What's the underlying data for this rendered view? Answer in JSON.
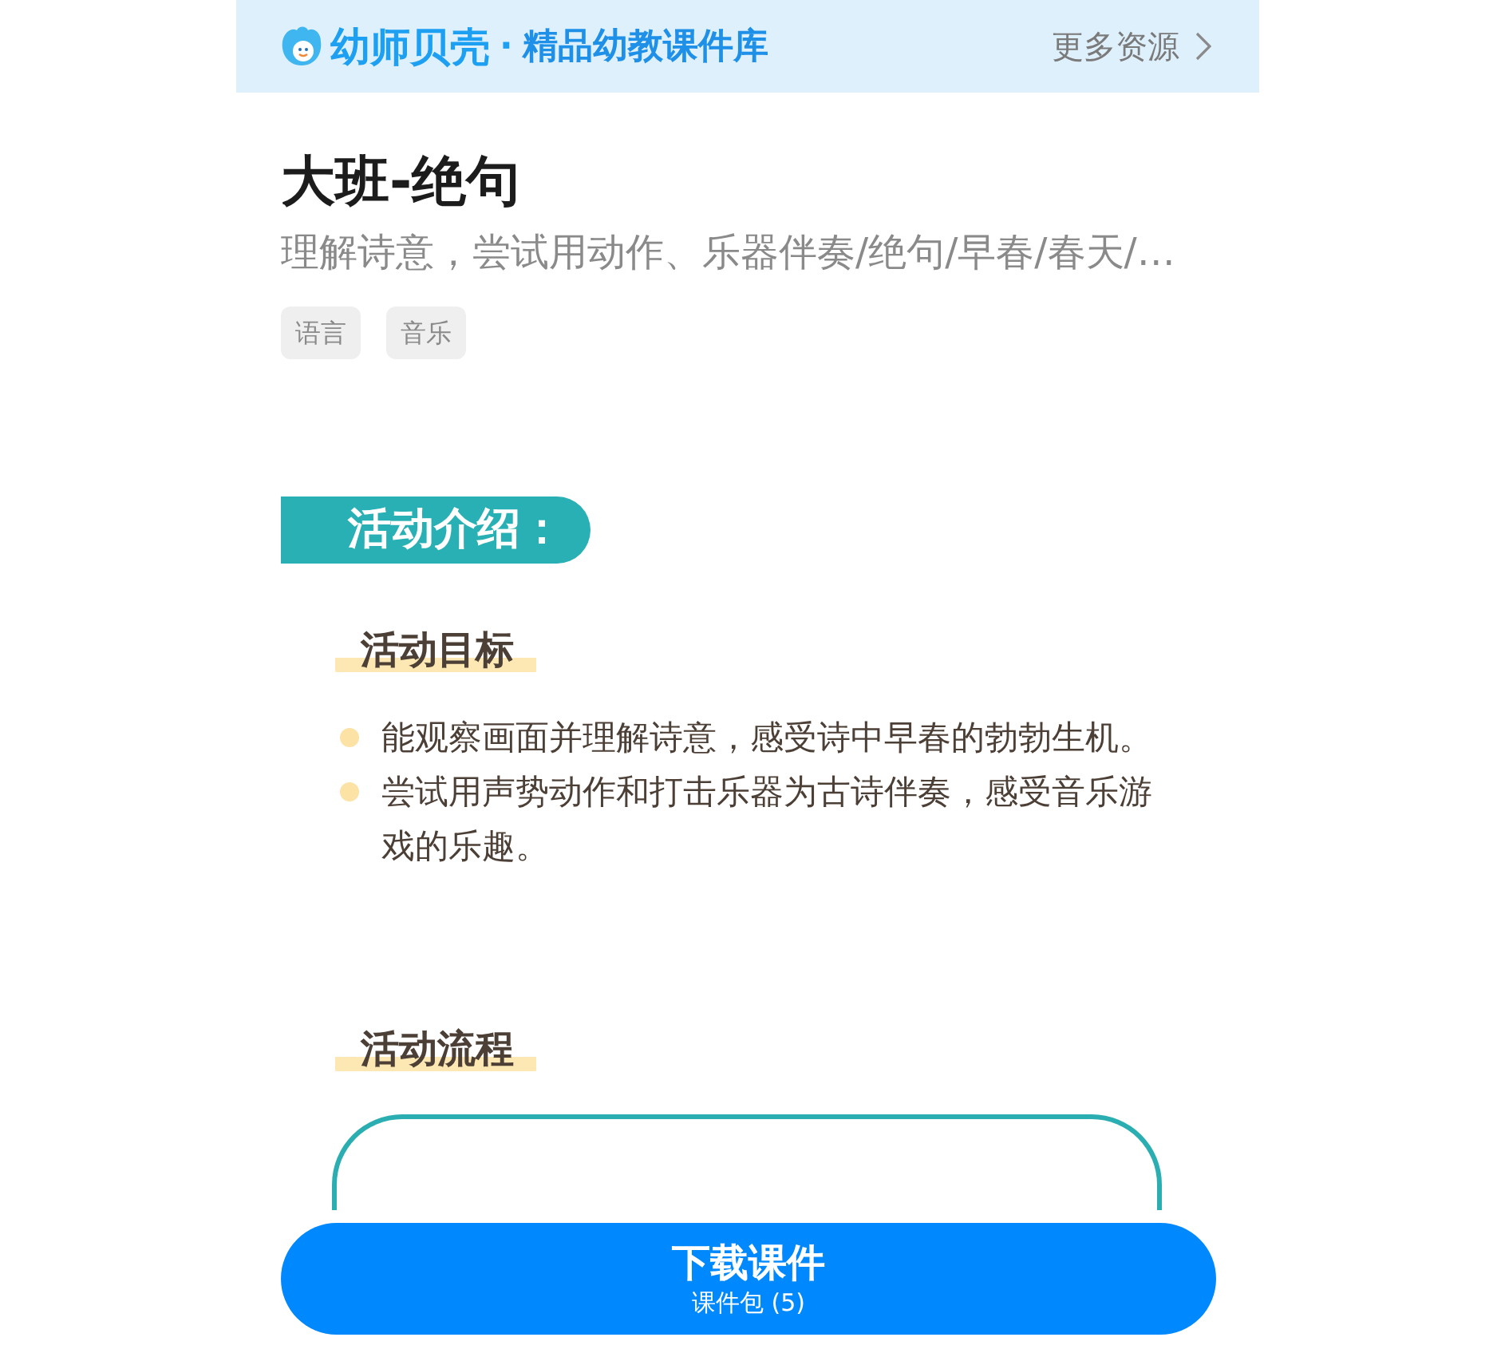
{
  "header": {
    "brand": "幼师贝壳",
    "separator": "·",
    "tagline": "精品幼教课件库",
    "more_link": "更多资源"
  },
  "course": {
    "title": "大班-绝句",
    "summary": "理解诗意，尝试用动作、乐器伴奏/绝句/早春/春天/…",
    "tags": [
      "语言",
      "音乐"
    ]
  },
  "intro": {
    "banner": "活动介绍：",
    "sections": [
      {
        "kind": "list",
        "heading": "活动目标",
        "bullets": [
          "能观察画面并理解诗意，感受诗中早春的勃勃生机。",
          "尝试用声势动作和打击乐器为古诗伴奏，感受音乐游戏的乐趣。"
        ]
      },
      {
        "kind": "frame",
        "heading": "活动流程"
      }
    ]
  },
  "download_button": {
    "label": "下载课件",
    "sublabel": "课件包 (5)"
  }
}
